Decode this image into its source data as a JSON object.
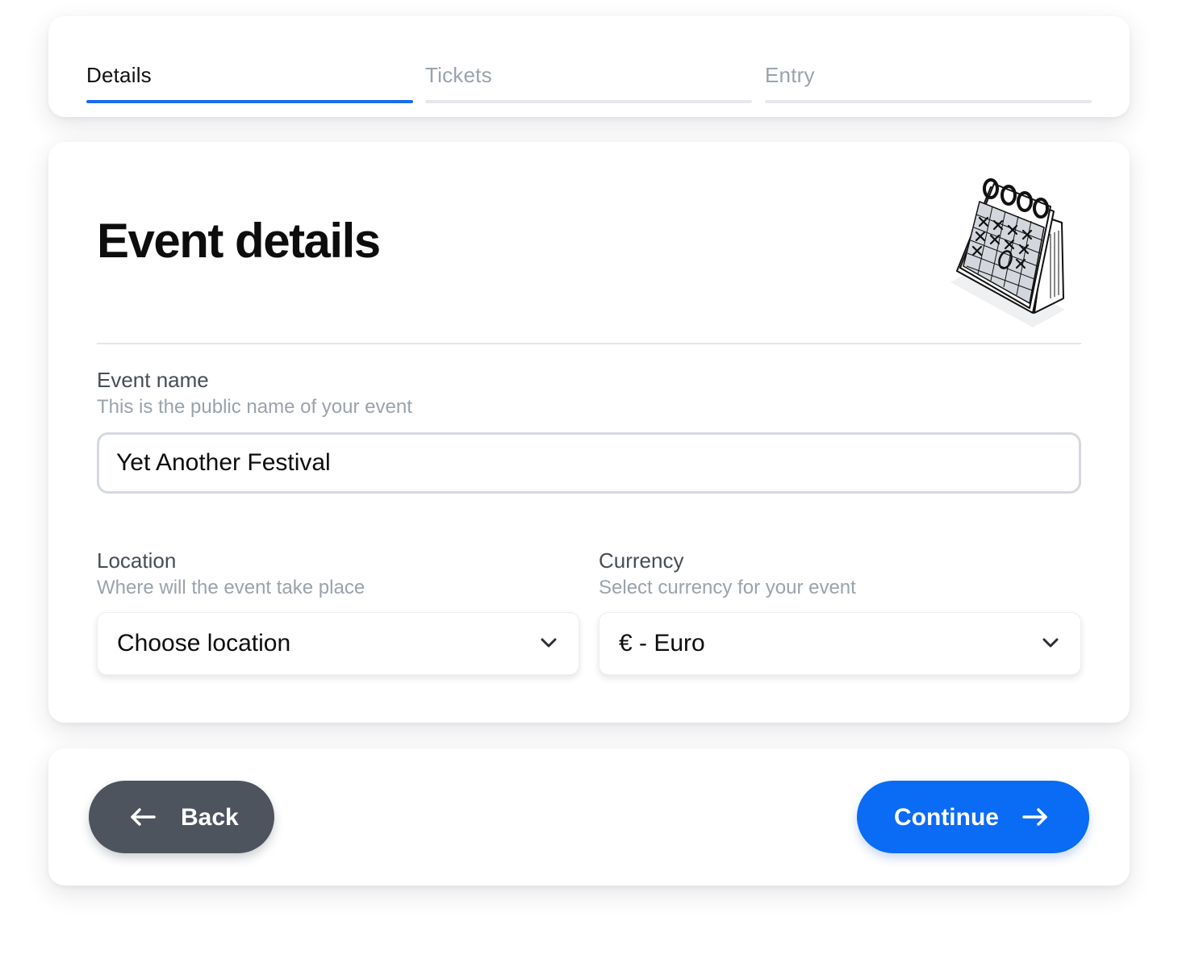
{
  "stepper": {
    "steps": [
      {
        "label": "Details",
        "state": "active"
      },
      {
        "label": "Tickets",
        "state": "inactive"
      },
      {
        "label": "Entry",
        "state": "inactive"
      }
    ]
  },
  "details": {
    "title": "Event details",
    "illustration": "calendar-illustration",
    "event_name": {
      "label": "Event name",
      "help": "This is the public name of your event",
      "value": "Yet Another Festival"
    },
    "location": {
      "label": "Location",
      "help": "Where will the event take place",
      "selected": "Choose location",
      "icon": "chevron-down-icon"
    },
    "currency": {
      "label": "Currency",
      "help": "Select currency for your event",
      "selected": "€ - Euro",
      "icon": "chevron-down-icon"
    }
  },
  "actions": {
    "back_label": "Back",
    "back_icon": "arrow-left-icon",
    "continue_label": "Continue",
    "continue_icon": "arrow-right-icon"
  },
  "colors": {
    "accent": "#0a6bf5",
    "step_active": "#1a6bf0",
    "back_button": "#4e545d",
    "muted_text": "#9aa2ac"
  }
}
